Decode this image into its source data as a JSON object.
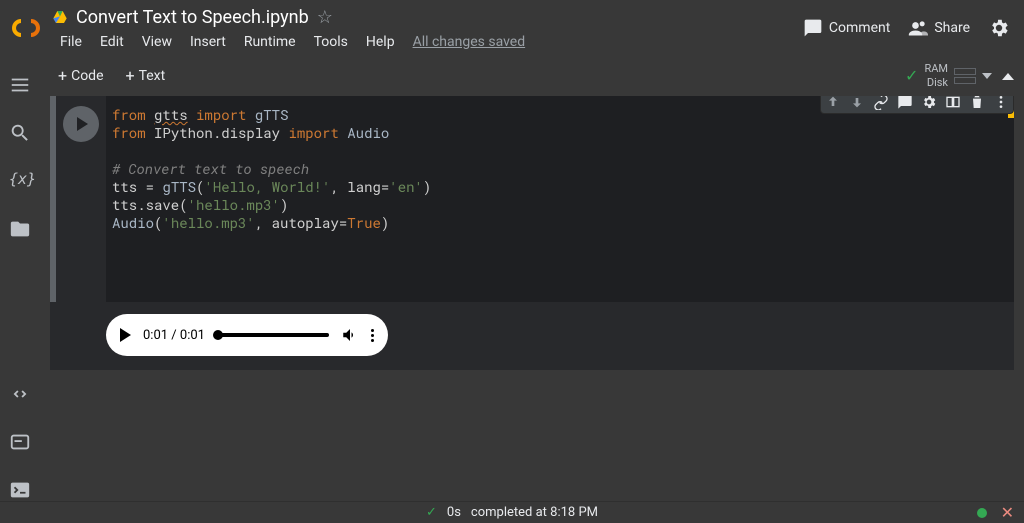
{
  "header": {
    "title": "Convert Text to Speech.ipynb",
    "menu": [
      "File",
      "Edit",
      "View",
      "Insert",
      "Runtime",
      "Tools",
      "Help"
    ],
    "save_status": "All changes saved",
    "comment_label": "Comment",
    "share_label": "Share"
  },
  "toolbar": {
    "code_label": "Code",
    "text_label": "Text",
    "connection": {
      "ram_label": "RAM",
      "disk_label": "Disk"
    }
  },
  "cell": {
    "code_lines": [
      [
        {
          "t": "kw",
          "v": "from"
        },
        {
          "t": "sp",
          "v": " "
        },
        {
          "t": "idu",
          "v": "gtts"
        },
        {
          "t": "sp",
          "v": " "
        },
        {
          "t": "kw",
          "v": "import"
        },
        {
          "t": "sp",
          "v": " "
        },
        {
          "t": "cls",
          "v": "gTTS"
        }
      ],
      [
        {
          "t": "kw",
          "v": "from"
        },
        {
          "t": "sp",
          "v": " "
        },
        {
          "t": "id",
          "v": "IPython.display"
        },
        {
          "t": "sp",
          "v": " "
        },
        {
          "t": "kw",
          "v": "import"
        },
        {
          "t": "sp",
          "v": " "
        },
        {
          "t": "cls",
          "v": "Audio"
        }
      ],
      [],
      [
        {
          "t": "cmt",
          "v": "# Convert text to speech"
        }
      ],
      [
        {
          "t": "id",
          "v": "tts"
        },
        {
          "t": "sp",
          "v": " = "
        },
        {
          "t": "cls",
          "v": "gTTS"
        },
        {
          "t": "id",
          "v": "("
        },
        {
          "t": "str",
          "v": "'Hello, World!'"
        },
        {
          "t": "id",
          "v": ", lang="
        },
        {
          "t": "str",
          "v": "'en'"
        },
        {
          "t": "id",
          "v": ")"
        }
      ],
      [
        {
          "t": "id",
          "v": "tts.save("
        },
        {
          "t": "str",
          "v": "'hello.mp3'"
        },
        {
          "t": "id",
          "v": ")"
        }
      ],
      [
        {
          "t": "cls",
          "v": "Audio"
        },
        {
          "t": "id",
          "v": "("
        },
        {
          "t": "str",
          "v": "'hello.mp3'"
        },
        {
          "t": "id",
          "v": ", autoplay="
        },
        {
          "t": "bool",
          "v": "True"
        },
        {
          "t": "id",
          "v": ")"
        }
      ]
    ],
    "output": {
      "audio": {
        "current": "0:01",
        "duration": "0:01"
      }
    }
  },
  "statusbar": {
    "duration": "0s",
    "message": "completed at 8:18 PM"
  }
}
